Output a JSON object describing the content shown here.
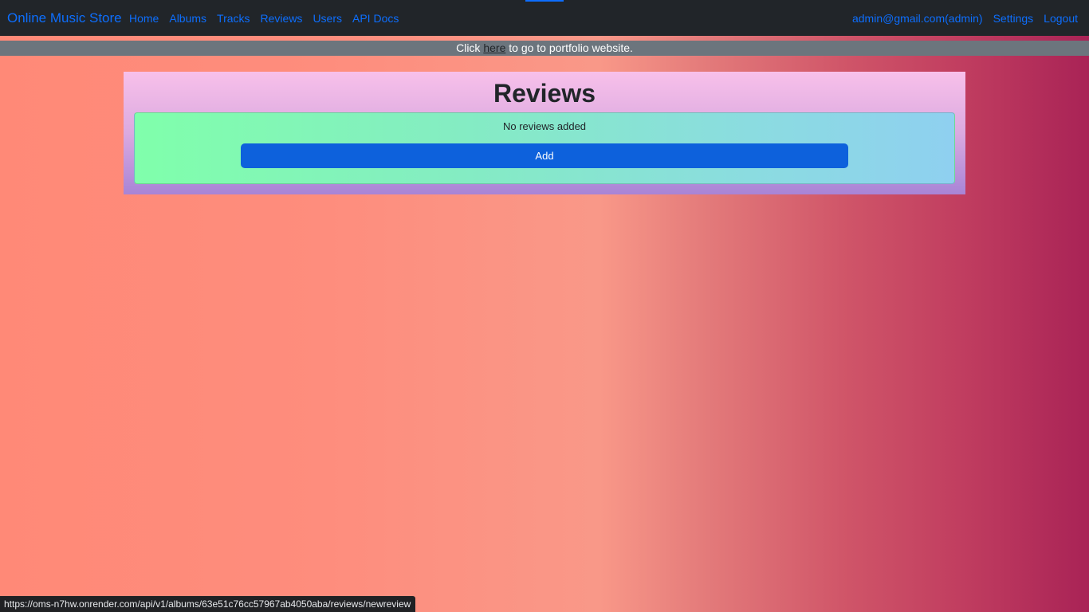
{
  "navbar": {
    "brand": "Online Music Store",
    "links": [
      "Home",
      "Albums",
      "Tracks",
      "Reviews",
      "Users",
      "API Docs"
    ],
    "user": "admin@gmail.com(admin)",
    "settings": "Settings",
    "logout": "Logout"
  },
  "banner": {
    "prefix": "Click ",
    "link": "here",
    "suffix": " to go to portfolio website."
  },
  "reviews": {
    "title": "Reviews",
    "empty_message": "No reviews added",
    "add_label": "Add"
  },
  "status_bar": {
    "url": "https://oms-n7hw.onrender.com/api/v1/albums/63e51c76cc57967ab4050aba/reviews/newreview"
  },
  "colors": {
    "navbar_bg": "#212529",
    "link": "#0d6efd",
    "banner_bg": "#6c757d",
    "button": "#0d61dc"
  }
}
